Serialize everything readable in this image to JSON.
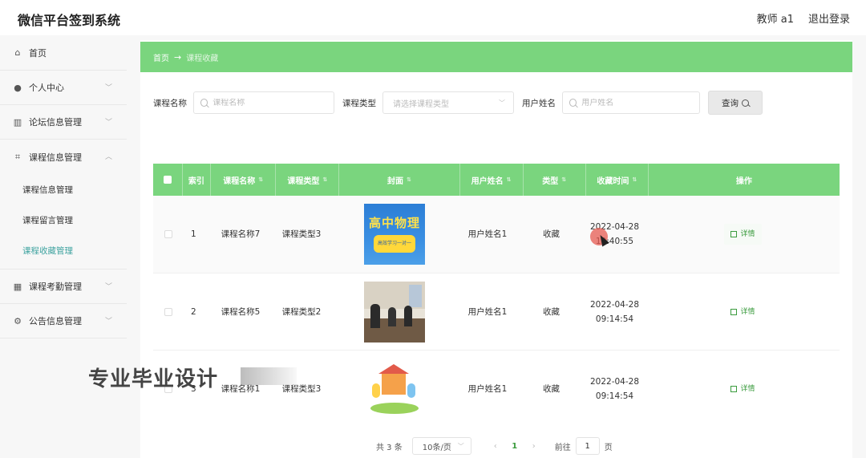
{
  "app": {
    "title": "微信平台签到系统"
  },
  "header": {
    "user_label": "教师 a1",
    "logout_label": "退出登录"
  },
  "sidebar": {
    "items": [
      {
        "label": "首页",
        "icon": "home-icon"
      },
      {
        "label": "个人中心",
        "icon": "user-icon"
      },
      {
        "label": "论坛信息管理",
        "icon": "chart-icon"
      },
      {
        "label": "课程信息管理",
        "icon": "crop-icon"
      },
      {
        "label": "课程考勤管理",
        "icon": "grid-icon"
      },
      {
        "label": "公告信息管理",
        "icon": "settings-icon"
      }
    ],
    "submenu": [
      {
        "label": "课程信息管理"
      },
      {
        "label": "课程留言管理"
      },
      {
        "label": "课程收藏管理",
        "active": true
      }
    ]
  },
  "breadcrumb": {
    "home": "首页",
    "arrow": "→",
    "current": "课程收藏"
  },
  "search": {
    "course_name_label": "课程名称",
    "course_name_placeholder": "课程名称",
    "course_type_label": "课程类型",
    "course_type_placeholder": "请选择课程类型",
    "user_name_label": "用户姓名",
    "user_name_placeholder": "用户姓名",
    "query_label": "查询"
  },
  "table": {
    "headers": [
      "索引",
      "课程名称",
      "课程类型",
      "封面",
      "用户姓名",
      "类型",
      "收藏时间",
      "操作"
    ],
    "rows": [
      {
        "index": "1",
        "course_name": "课程名称7",
        "course_type": "课程类型3",
        "cover_title": "高中物理",
        "cover_sub": "高效学习一对一",
        "user_name": "用户姓名1",
        "type": "收藏",
        "date": "2022-04-28",
        "time": "10:40:55",
        "action": "详情"
      },
      {
        "index": "2",
        "course_name": "课程名称5",
        "course_type": "课程类型2",
        "user_name": "用户姓名1",
        "type": "收藏",
        "date": "2022-04-28",
        "time": "09:14:54",
        "action": "详情"
      },
      {
        "index": "3",
        "course_name": "课程名称1",
        "course_type": "课程类型3",
        "user_name": "用户姓名1",
        "type": "收藏",
        "date": "2022-04-28",
        "time": "09:14:54",
        "action": "详情"
      }
    ]
  },
  "pagination": {
    "total": "共 3 条",
    "page_size": "10条/页",
    "prev": "‹",
    "current_page": "1",
    "next": "›",
    "goto_label": "前往",
    "goto_value": "1",
    "page_unit": "页"
  },
  "watermark": {
    "text": "专业毕业设计"
  },
  "colors": {
    "accent": "#7ad57e",
    "active_link": "#3fa3a0",
    "action_text": "#3a9b3d"
  }
}
